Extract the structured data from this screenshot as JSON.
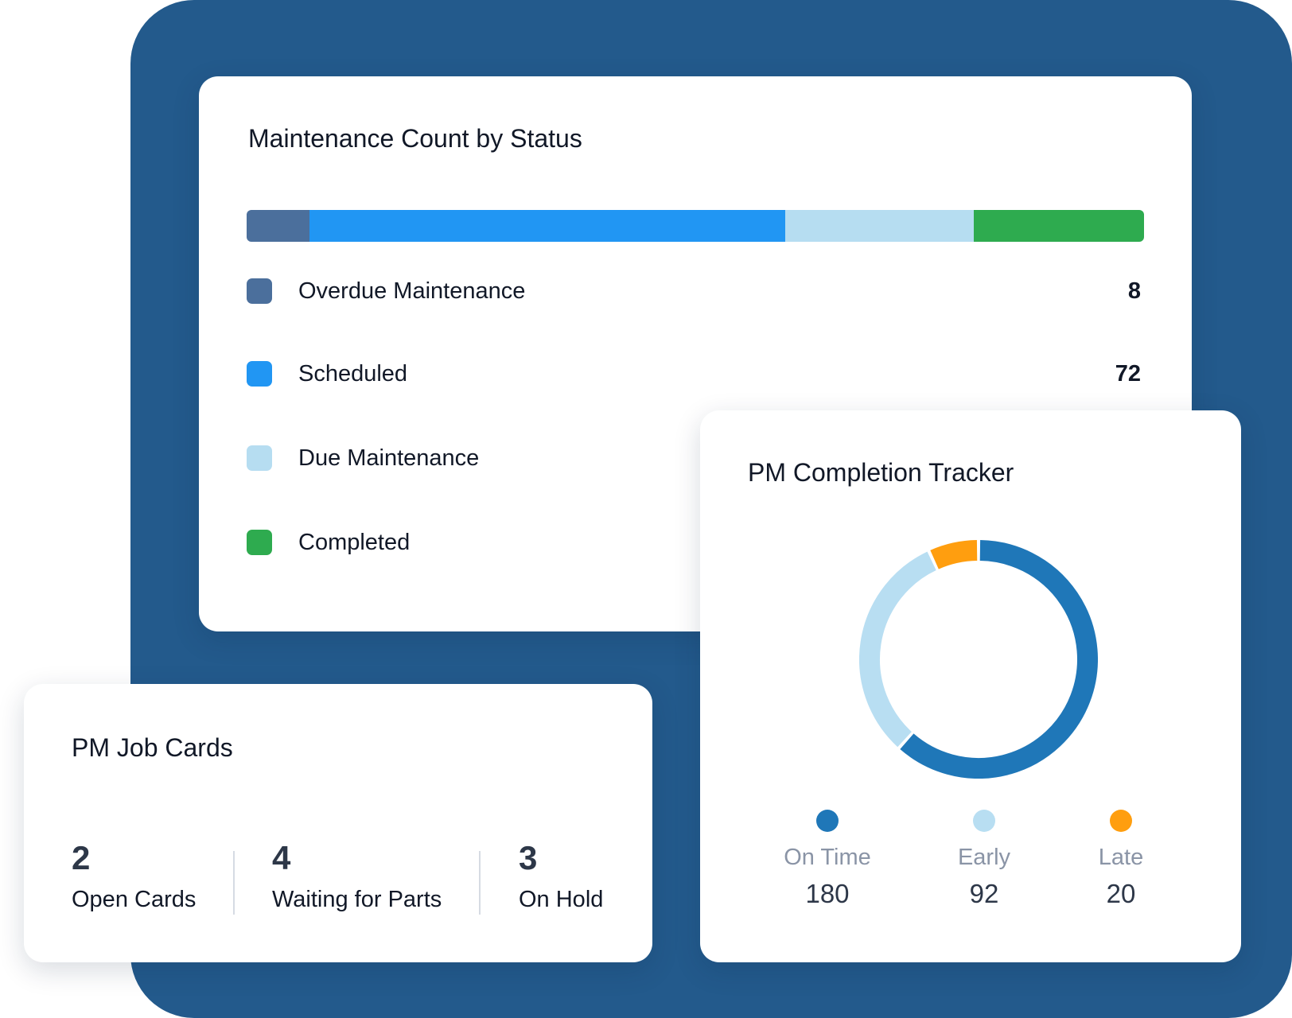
{
  "colors": {
    "backdrop": "#235a8c",
    "overdue": "#4b6f9c",
    "scheduled": "#2196f3",
    "due": "#b6ddf1",
    "completed": "#2eab4f",
    "on_time": "#1f77b8",
    "early": "#b8def2",
    "late": "#ff9e0f"
  },
  "status_card": {
    "title": "Maintenance Count by Status",
    "bar_segments": [
      {
        "key": "overdue",
        "share": 0.07
      },
      {
        "key": "scheduled",
        "share": 0.53
      },
      {
        "key": "due",
        "share": 0.21
      },
      {
        "key": "completed",
        "share": 0.19
      }
    ],
    "legend": [
      {
        "label": "Overdue Maintenance",
        "value": "8",
        "color": "#4b6f9c"
      },
      {
        "label": "Scheduled",
        "value": "72",
        "color": "#2196f3"
      },
      {
        "label": "Due Maintenance",
        "value": "",
        "color": "#b6ddf1"
      },
      {
        "label": "Completed",
        "value": "",
        "color": "#2eab4f"
      }
    ]
  },
  "job_cards": {
    "title": "PM Job Cards",
    "stats": [
      {
        "value": "2",
        "label": "Open Cards"
      },
      {
        "value": "4",
        "label": "Waiting for Parts"
      },
      {
        "value": "3",
        "label": "On Hold"
      }
    ]
  },
  "tracker": {
    "title": "PM Completion Tracker",
    "legend": [
      {
        "label": "On Time",
        "value": "180",
        "color": "#1f77b8"
      },
      {
        "label": "Early",
        "value": "92",
        "color": "#b8def2"
      },
      {
        "label": "Late",
        "value": "20",
        "color": "#ff9e0f"
      }
    ]
  },
  "chart_data": {
    "type": "pie",
    "categories": [
      "On Time",
      "Early",
      "Late"
    ],
    "values": [
      180,
      92,
      20
    ],
    "title": "PM Completion Tracker"
  }
}
